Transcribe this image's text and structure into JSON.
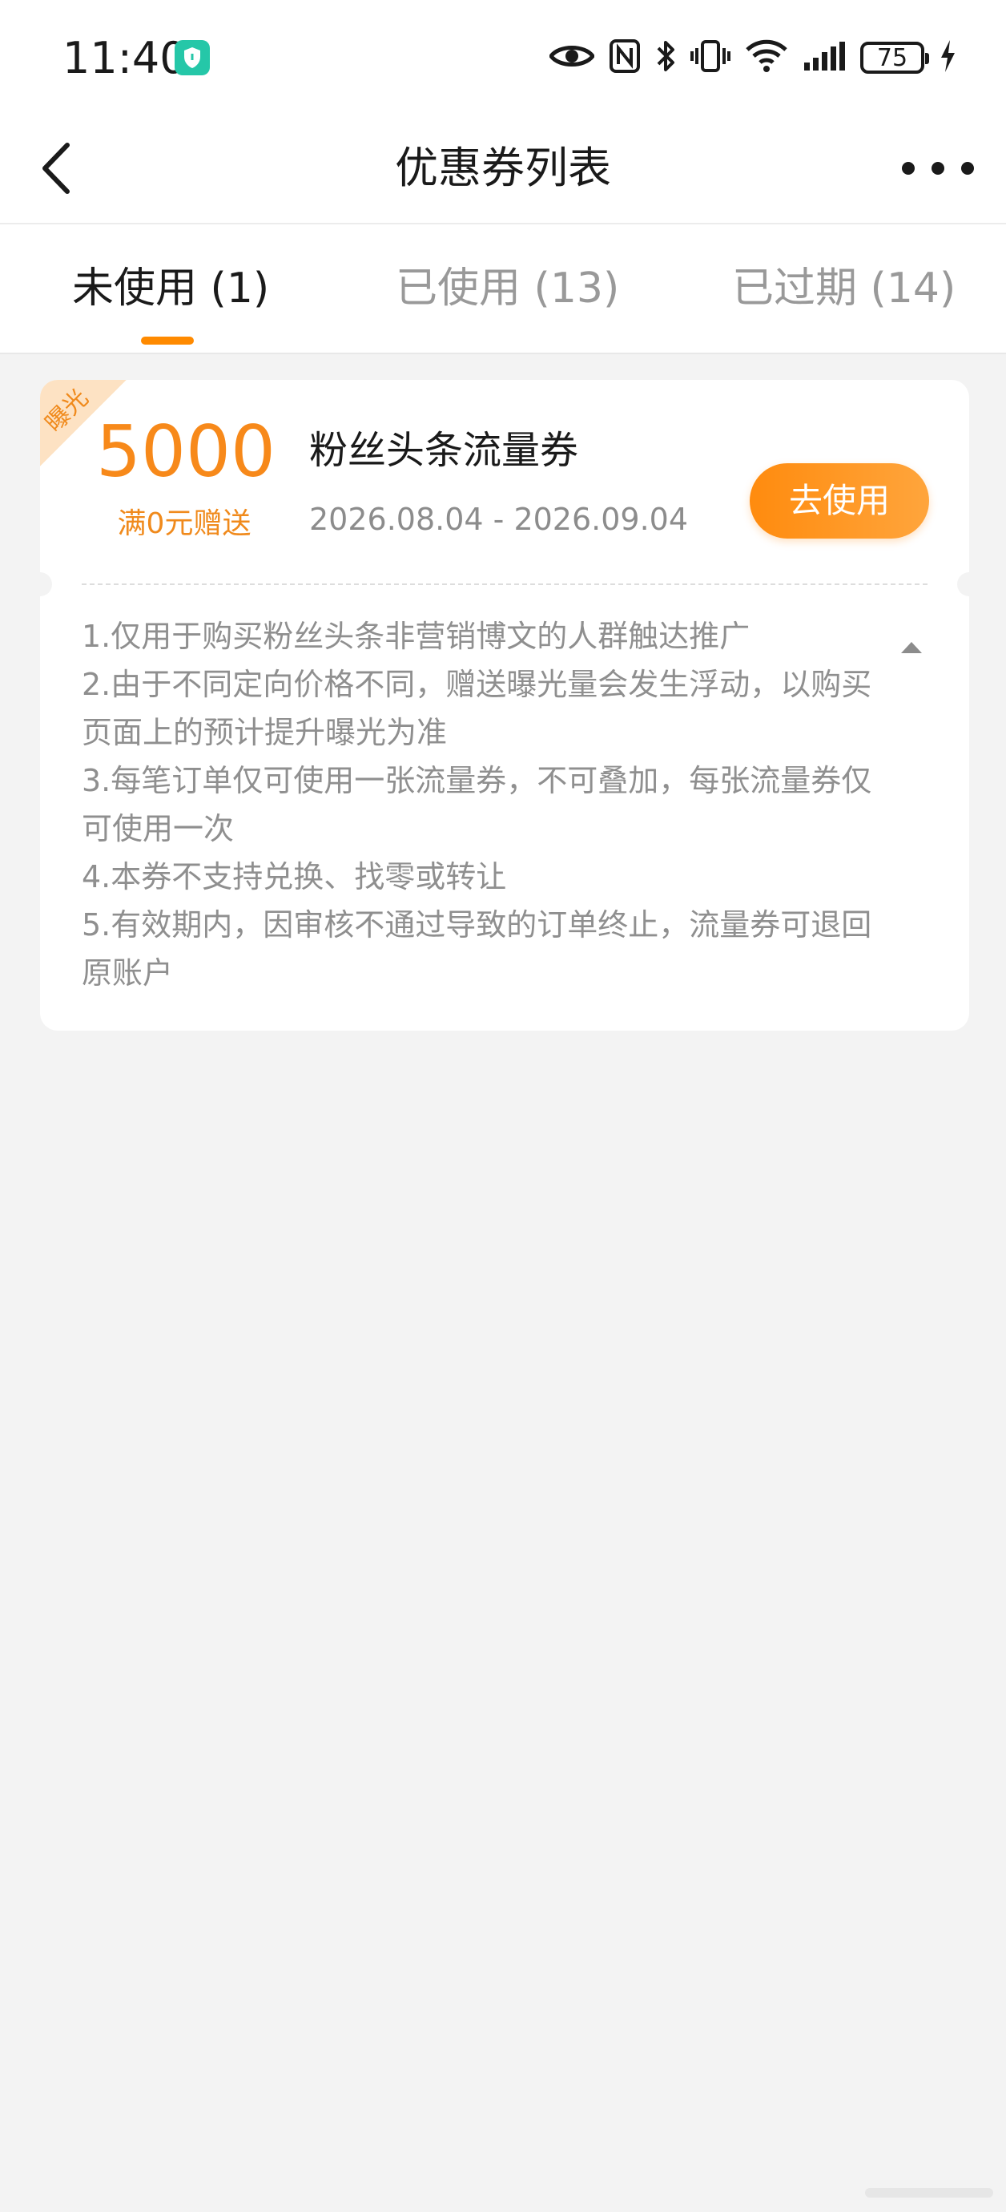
{
  "status_bar": {
    "time": "11:40",
    "battery": "75",
    "icons": [
      "shield-icon",
      "eye-icon",
      "nfc-icon",
      "bluetooth-icon",
      "vibrate-icon",
      "wifi-icon",
      "signal-icon",
      "battery-icon",
      "charging-icon"
    ]
  },
  "nav": {
    "title": "优惠券列表"
  },
  "tabs": [
    {
      "label": "未使用 (1)",
      "active": true
    },
    {
      "label": "已使用 (13)",
      "active": false
    },
    {
      "label": "已过期 (14)",
      "active": false
    }
  ],
  "coupon": {
    "tag": "曝光",
    "amount": "5000",
    "condition": "满0元赠送",
    "name": "粉丝头条流量券",
    "validity": "2026.08.04 - 2026.09.04",
    "button_label": "去使用",
    "rules": [
      "1.仅用于购买粉丝头条非营销博文的人群触达推广",
      "2.由于不同定向价格不同，赠送曝光量会发生浮动，以购买页面上的预计提升曝光为准",
      "3.每笔订单仅可使用一张流量券，不可叠加，每张流量券仅可使用一次",
      "4.本券不支持兑换、找零或转让",
      "5.有效期内，因审核不通过导致的订单终止，流量券可退回原账户"
    ]
  },
  "colors": {
    "accent": "#ff8a00",
    "background": "#f3f3f3"
  }
}
